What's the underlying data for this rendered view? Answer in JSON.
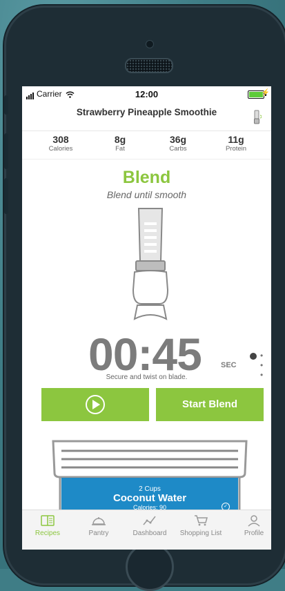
{
  "status_bar": {
    "carrier": "Carrier",
    "time": "12:00"
  },
  "recipe": {
    "title": "Strawberry Pineapple Smoothie"
  },
  "nutrition": [
    {
      "value": "308",
      "label": "Calories"
    },
    {
      "value": "8g",
      "label": "Fat"
    },
    {
      "value": "36g",
      "label": "Carbs"
    },
    {
      "value": "11g",
      "label": "Protein"
    }
  ],
  "step": {
    "title": "Blend",
    "subtitle": "Blend until smooth",
    "timer": "00:45",
    "timer_unit": "SEC",
    "instruction": "Secure and twist on blade."
  },
  "buttons": {
    "start_label": "Start Blend"
  },
  "ingredient": {
    "quantity": "2 Cups",
    "name": "Coconut Water",
    "calories": "Calories: 90"
  },
  "tabs": [
    {
      "label": "Recipes",
      "icon": "recipes-book-icon",
      "active": true
    },
    {
      "label": "Pantry",
      "icon": "cloche-icon",
      "active": false
    },
    {
      "label": "Dashboard",
      "icon": "line-chart-icon",
      "active": false
    },
    {
      "label": "Shopping List",
      "icon": "cart-icon",
      "active": false
    },
    {
      "label": "Profile",
      "icon": "person-icon",
      "active": false
    }
  ],
  "colors": {
    "accent_green": "#8cc63f",
    "ingredient_blue": "#1e8ac7",
    "background_teal": "#3f7d86"
  }
}
